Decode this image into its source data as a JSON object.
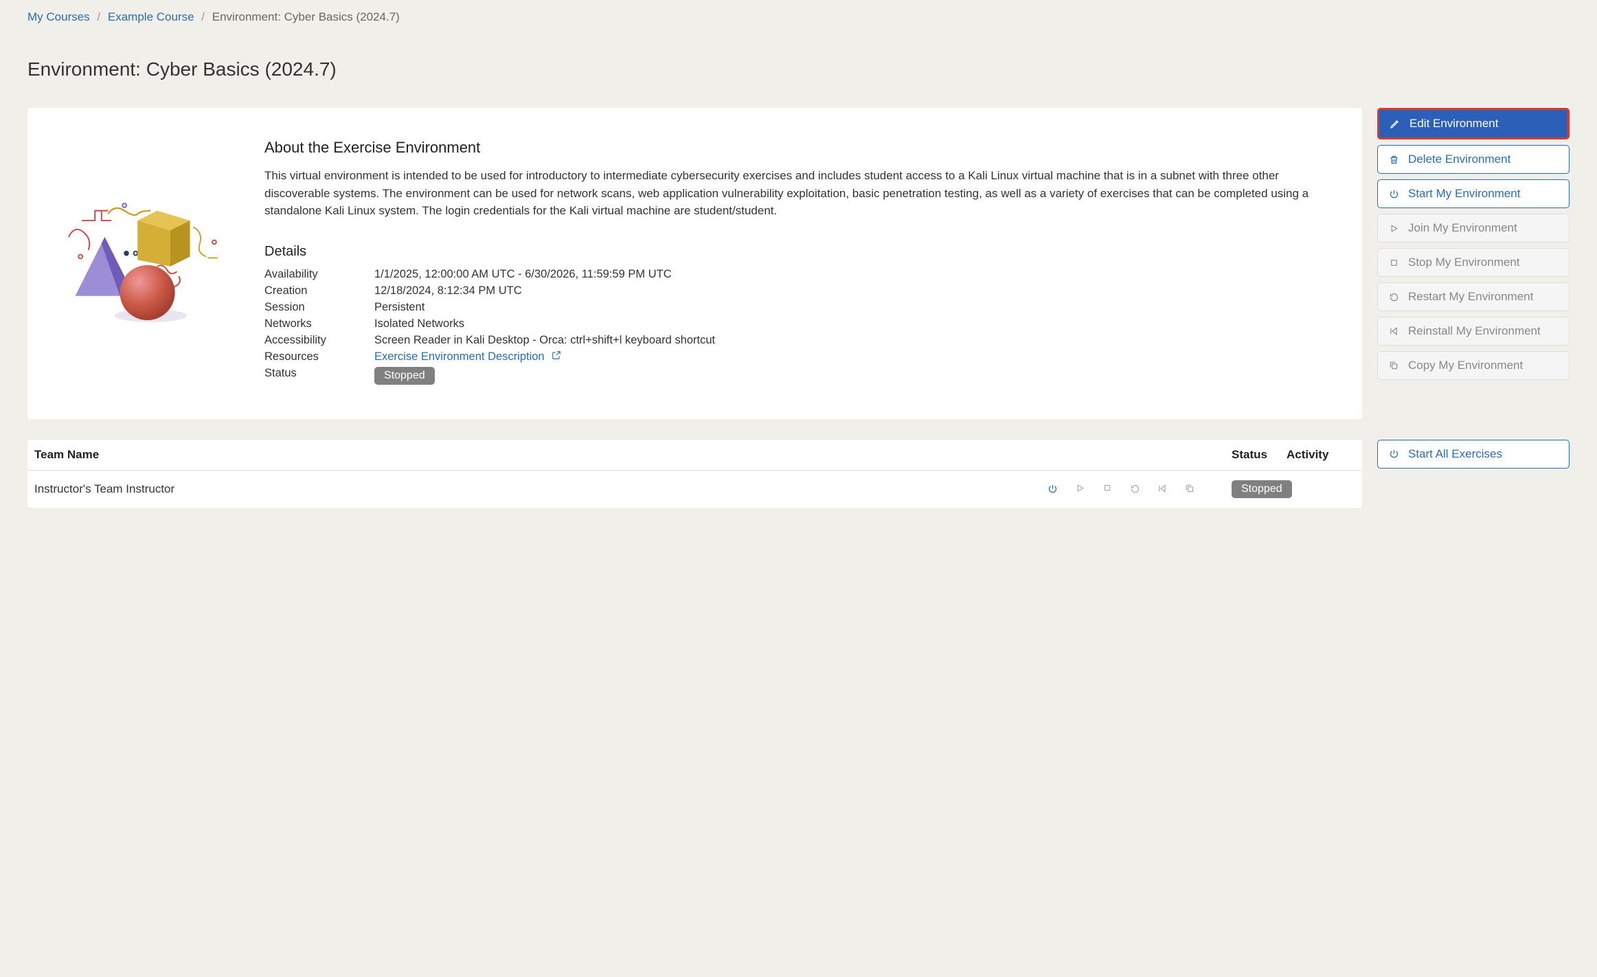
{
  "breadcrumb": {
    "items": [
      {
        "label": "My Courses",
        "link": true
      },
      {
        "label": "Example Course",
        "link": true
      },
      {
        "label": "Environment: Cyber Basics (2024.7)",
        "link": false
      }
    ]
  },
  "page": {
    "title": "Environment: Cyber Basics (2024.7)"
  },
  "about": {
    "heading": "About the Exercise Environment",
    "description": "This virtual environment is intended to be used for introductory to intermediate cybersecurity exercises and includes student access to a Kali Linux virtual machine that is in a subnet with three other discoverable systems. The environment can be used for network scans, web application vulnerability exploitation, basic penetration testing, as well as a variety of exercises that can be completed using a standalone Kali Linux system. The login credentials for the Kali virtual machine are student/student."
  },
  "details": {
    "heading": "Details",
    "rows": {
      "availability": {
        "label": "Availability",
        "value": "1/1/2025, 12:00:00 AM UTC - 6/30/2026, 11:59:59 PM UTC"
      },
      "creation": {
        "label": "Creation",
        "value": "12/18/2024, 8:12:34 PM UTC"
      },
      "session": {
        "label": "Session",
        "value": "Persistent"
      },
      "networks": {
        "label": "Networks",
        "value": "Isolated Networks"
      },
      "accessibility": {
        "label": "Accessibility",
        "value": "Screen Reader in Kali Desktop - Orca: ctrl+shift+l keyboard shortcut"
      },
      "resources": {
        "label": "Resources",
        "link_text": "Exercise Environment Description"
      },
      "status": {
        "label": "Status",
        "badge": "Stopped"
      }
    }
  },
  "actions": {
    "edit": "Edit Environment",
    "delete": "Delete Environment",
    "start": "Start My Environment",
    "join": "Join My Environment",
    "stop": "Stop My Environment",
    "restart": "Restart My Environment",
    "reinstall": "Reinstall My Environment",
    "copy": "Copy My Environment",
    "start_all": "Start All Exercises"
  },
  "table": {
    "headers": {
      "team": "Team Name",
      "status": "Status",
      "activity": "Activity"
    },
    "row": {
      "team": "Instructor's Team Instructor",
      "status": "Stopped"
    }
  }
}
